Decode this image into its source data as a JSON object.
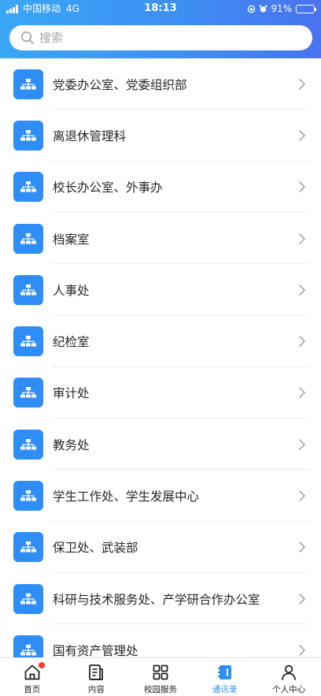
{
  "status_bar": {
    "carrier": "中国移动",
    "network": "4G",
    "time": "18:13",
    "battery": "91%",
    "battery_level": 0.91
  },
  "search": {
    "placeholder": "搜索"
  },
  "departments": [
    "党委办公室、党委组织部",
    "离退休管理科",
    "校长办公室、外事办",
    "档案室",
    "人事处",
    "纪检室",
    "审计处",
    "教务处",
    "学生工作处、学生发展中心",
    "保卫处、武装部",
    "科研与技术服务处、产学研合作办公室",
    "国有资产管理处"
  ],
  "tabbar": {
    "items": [
      {
        "label": "首页",
        "icon": "home-icon",
        "badge": true
      },
      {
        "label": "内容",
        "icon": "content-icon"
      },
      {
        "label": "校园服务",
        "icon": "grid-icon"
      },
      {
        "label": "通讯录",
        "icon": "contacts-icon",
        "active": true
      },
      {
        "label": "个人中心",
        "icon": "person-icon"
      }
    ]
  },
  "colors": {
    "accent": "#2f8ef6",
    "header_start": "#3aa7f5",
    "header_end": "#4a73ef",
    "badge": "#f23c3c"
  }
}
